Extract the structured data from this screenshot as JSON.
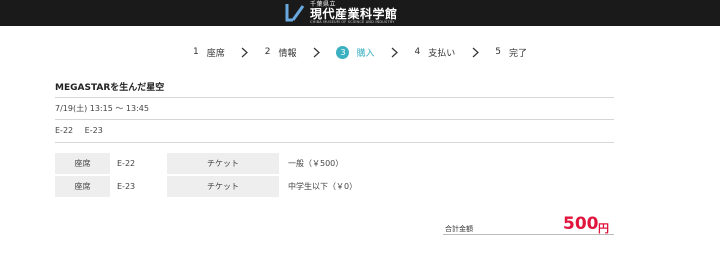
{
  "header": {
    "logo_small": "千葉県立",
    "logo_main": "現代産業科学館",
    "logo_en": "CHIBA MUSEUM OF SCIENCE AND INDUSTRY"
  },
  "steps": [
    {
      "num": "1",
      "label": "座席",
      "active": false
    },
    {
      "num": "2",
      "label": "情報",
      "active": false
    },
    {
      "num": "3",
      "label": "購入",
      "active": true
    },
    {
      "num": "4",
      "label": "支払い",
      "active": false
    },
    {
      "num": "5",
      "label": "完了",
      "active": false
    }
  ],
  "event": {
    "title": "MEGASTARを生んだ星空",
    "datetime": "7/19(土) 13:15 ～ 13:45",
    "seats": [
      "E-22",
      "E-23"
    ]
  },
  "tickets": {
    "seat_header": "座席",
    "ticket_header": "チケット",
    "rows": [
      {
        "seat": "E-22",
        "ticket": "一般（￥500）"
      },
      {
        "seat": "E-23",
        "ticket": "中学生以下（￥0）"
      }
    ]
  },
  "total": {
    "label": "合計金額",
    "amount": "500",
    "unit": "円"
  },
  "colors": {
    "accent": "#3ab0c0",
    "total": "#e0143c",
    "header_bg": "#1a1a1a"
  }
}
